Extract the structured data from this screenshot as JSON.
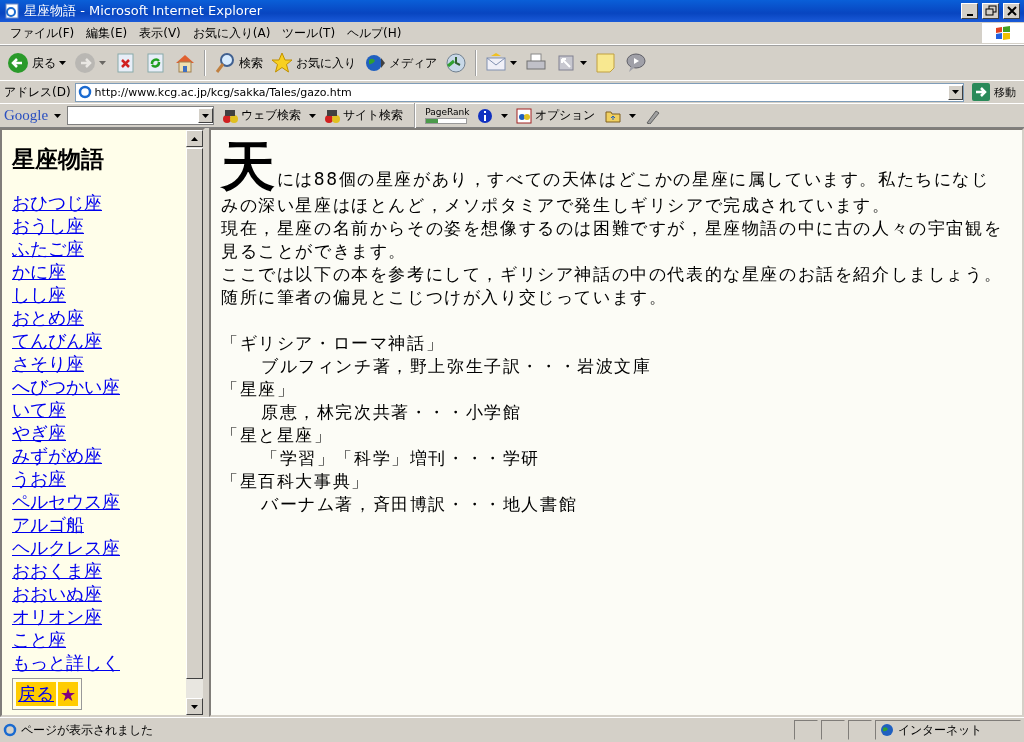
{
  "window": {
    "title": "星座物語 - Microsoft Internet Explorer"
  },
  "menu": [
    "ファイル(F)",
    "編集(E)",
    "表示(V)",
    "お気に入り(A)",
    "ツール(T)",
    "ヘルプ(H)"
  ],
  "toolbar": [
    {
      "kind": "back",
      "label": "戻る",
      "dropdown": true,
      "disabled": false
    },
    {
      "kind": "forward",
      "dropdown": true,
      "disabled": true
    },
    {
      "kind": "stop",
      "dropdown": false,
      "disabled": false
    },
    {
      "kind": "refresh",
      "dropdown": false,
      "disabled": false
    },
    {
      "kind": "home",
      "dropdown": false,
      "disabled": false
    },
    {
      "kind": "search",
      "label": "検索",
      "dropdown": false,
      "disabled": false
    },
    {
      "kind": "favorites",
      "label": "お気に入り",
      "dropdown": false,
      "disabled": false
    },
    {
      "kind": "media",
      "label": "メディア",
      "dropdown": false,
      "disabled": false
    },
    {
      "kind": "history",
      "dropdown": false,
      "disabled": false
    },
    {
      "kind": "mail",
      "dropdown": true,
      "disabled": false
    },
    {
      "kind": "print",
      "dropdown": false,
      "disabled": false
    },
    {
      "kind": "edit",
      "dropdown": true,
      "disabled": false
    },
    {
      "kind": "note",
      "dropdown": false,
      "disabled": false
    },
    {
      "kind": "messenger",
      "dropdown": false,
      "disabled": false
    }
  ],
  "address_bar": {
    "label": "アドレス(D)",
    "value": "http://www.kcg.ac.jp/kcg/sakka/Tales/gazo.htm",
    "go": "移動"
  },
  "google_bar": {
    "logo": "Google",
    "items": [
      {
        "kind": "web",
        "label": "ウェブ検索"
      },
      {
        "kind": "site",
        "label": "サイト検索"
      },
      {
        "kind": "pagerank",
        "label": "PageRank",
        "level": 0.3
      },
      {
        "kind": "info"
      },
      {
        "kind": "options",
        "label": "オプション"
      },
      {
        "kind": "folder"
      },
      {
        "kind": "pen"
      }
    ]
  },
  "sidebar": {
    "title": "星座物語",
    "links": [
      "おひつじ座",
      "おうし座",
      "ふたご座",
      "かに座",
      "しし座",
      "おとめ座",
      "てんびん座",
      "さそり座",
      "へびつかい座",
      "いて座",
      "やぎ座",
      "みずがめ座",
      "うお座",
      "ペルセウス座",
      "アルゴ船",
      "ヘルクレス座",
      "おおくま座",
      "おおいぬ座",
      "オリオン座",
      "こと座",
      "もっと詳しく"
    ],
    "back_button": "戻る",
    "star_button": "★"
  },
  "main": {
    "drop_cap": "天",
    "paragraphs": [
      "には88個の星座があり，すべての天体はどこかの星座に属しています。私たちになじみの深い星座はほとんど，メソポタミアで発生しギリシアで完成されています。",
      "現在，星座の名前からその姿を想像するのは困難ですが，星座物語の中に古の人々の宇宙観を見ることができます。",
      "ここでは以下の本を参考にして，ギリシア神話の中の代表的な星座のお話を紹介しましょう。随所に筆者の偏見とこじつけが入り交じっています。"
    ],
    "books": [
      {
        "title": "「ギリシア・ローマ神話」",
        "detail": "ブルフィンチ著，野上弥生子訳・・・岩波文庫"
      },
      {
        "title": "「星座」",
        "detail": "原恵，林完次共著・・・小学館"
      },
      {
        "title": "「星と星座」",
        "detail": "「学習」「科学」増刊・・・学研"
      },
      {
        "title": "「星百科大事典」",
        "detail": "バーナム著，斉田博訳・・・地人書館"
      }
    ]
  },
  "status_bar": {
    "text": "ページが表示されました",
    "zone": "インターネット"
  }
}
